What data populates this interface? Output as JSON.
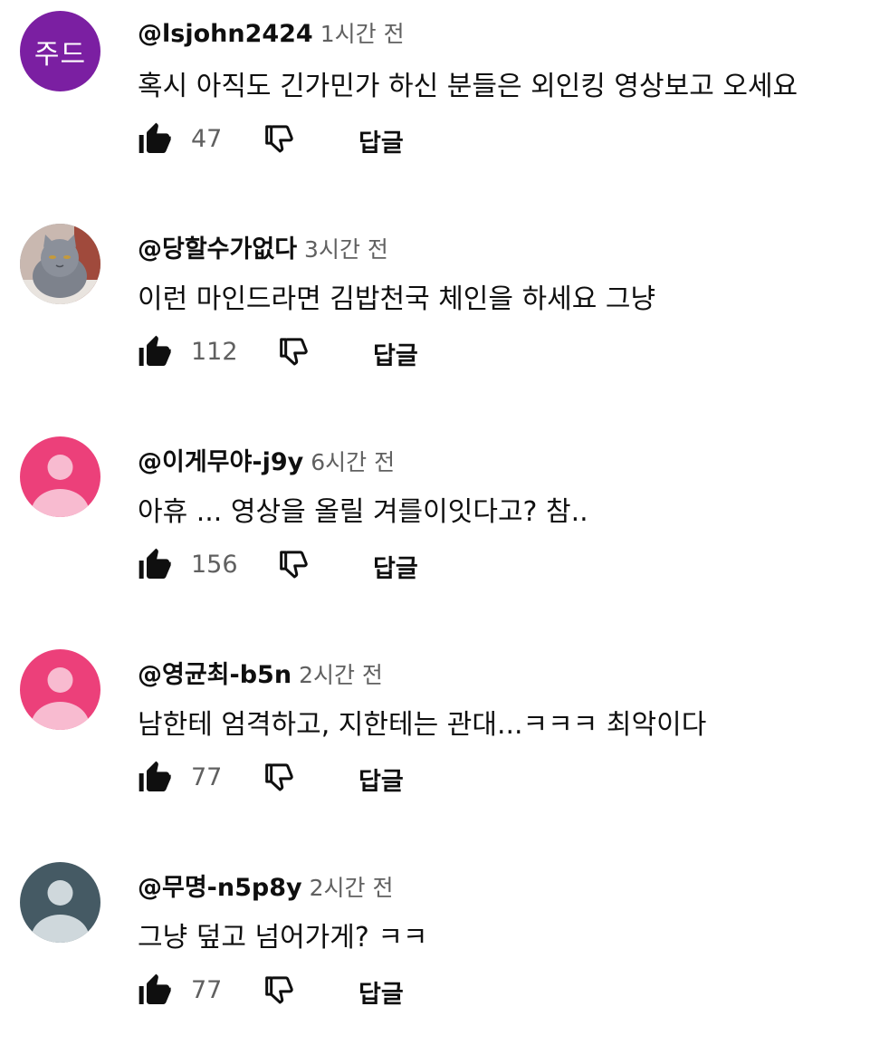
{
  "comments": [
    {
      "author": "@lsjohn2424",
      "time": "1시간 전",
      "text": "혹시 아직도 긴가민가 하신 분들은 외인킹 영상보고 오세요",
      "likes": "47",
      "reply_label": "답글",
      "avatar": {
        "kind": "initials",
        "initials": "주드",
        "color": "#7b1fa2"
      }
    },
    {
      "author": "@당할수가없다",
      "time": "3시간 전",
      "text": "이런 마인드라면 김밥천국 체인을 하세요 그냥",
      "likes": "112",
      "reply_label": "답글",
      "avatar": {
        "kind": "photo",
        "subject": "gray-cat",
        "color": "#8a8f99"
      }
    },
    {
      "author": "@이게무야-j9y",
      "time": "6시간 전",
      "text": "아휴 ... 영상을 올릴 겨를이잇다고? 참..",
      "likes": "156",
      "reply_label": "답글",
      "avatar": {
        "kind": "default",
        "color": "#ec407a"
      }
    },
    {
      "author": "@영균최-b5n",
      "time": "2시간 전",
      "text": "남한테 엄격하고, 지한테는 관대...ㅋㅋㅋ 최악이다",
      "likes": "77",
      "reply_label": "답글",
      "avatar": {
        "kind": "default",
        "color": "#ec407a"
      }
    },
    {
      "author": "@무명-n5p8y",
      "time": "2시간 전",
      "text": "그냥 덮고 넘어가게? ㅋㅋ",
      "likes": "77",
      "reply_label": "답글",
      "avatar": {
        "kind": "default",
        "color": "#455a64"
      }
    }
  ]
}
